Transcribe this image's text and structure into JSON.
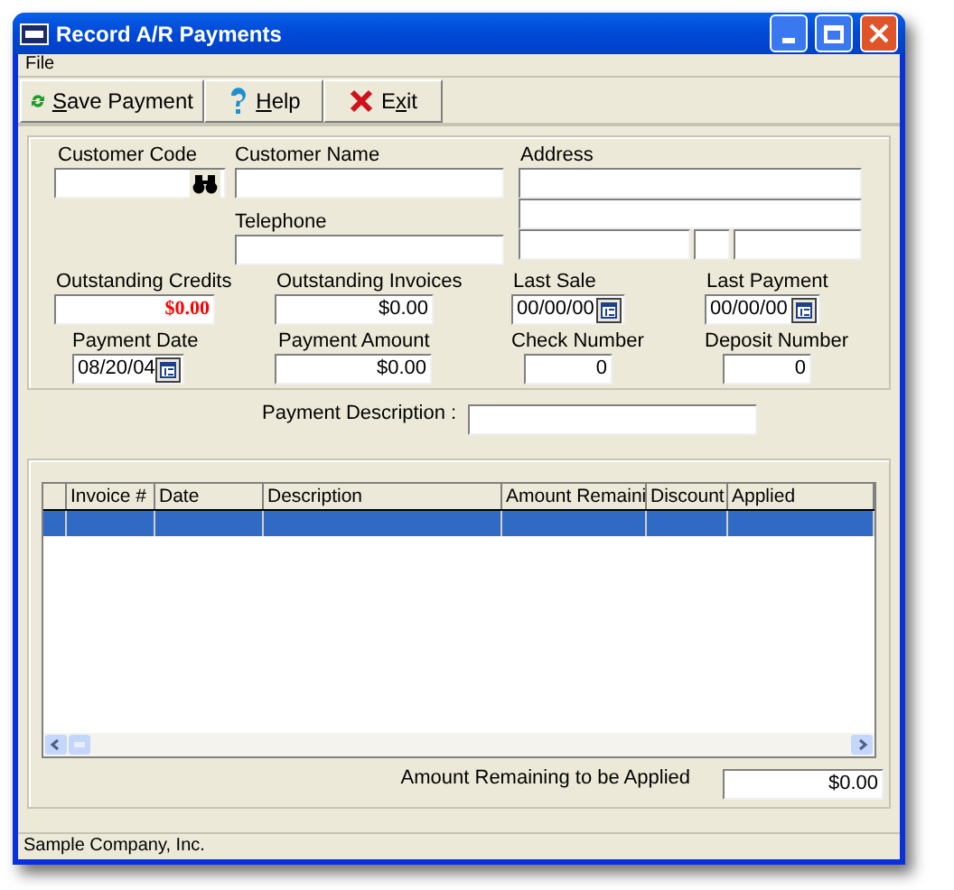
{
  "window": {
    "title": "Record A/R Payments"
  },
  "menu": [
    "File"
  ],
  "toolbar": [
    {
      "kind": "save",
      "accel": "S",
      "after": "ave Payment"
    },
    {
      "kind": "help",
      "accel": "H",
      "after": "elp"
    },
    {
      "kind": "exit",
      "before": "E",
      "accel": "x",
      "after": "it"
    }
  ],
  "customer": {
    "code_label": "Customer Code",
    "name_label": "Customer Name",
    "telephone_label": "Telephone",
    "address_label": "Address"
  },
  "summary": [
    {
      "label": "Outstanding Credits",
      "value": "$0.00",
      "kind": "money",
      "emphasis": true
    },
    {
      "label": "Outstanding Invoices",
      "value": "$0.00",
      "kind": "money",
      "emphasis": false
    },
    {
      "label": "Last Sale",
      "value": "00/00/00",
      "kind": "date",
      "emphasis": false
    },
    {
      "label": "Last Payment",
      "value": "00/00/00",
      "kind": "date",
      "emphasis": false
    }
  ],
  "payment": [
    {
      "label": "Payment Date",
      "value": "08/20/04",
      "kind": "date"
    },
    {
      "label": "Payment Amount",
      "value": "$0.00",
      "kind": "money"
    },
    {
      "label": "Check Number",
      "value": "0",
      "kind": "number"
    },
    {
      "label": "Deposit Number",
      "value": "0",
      "kind": "number"
    }
  ],
  "description": {
    "label": "Payment Description :"
  },
  "table": {
    "columns": [
      "Invoice #",
      "Date",
      "Description",
      "Amount Remaini",
      "Discount",
      "Applied"
    ],
    "rows": [
      {
        "selected": true
      }
    ]
  },
  "remaining": {
    "label": "Amount Remaining to be Applied",
    "value": "$0.00"
  },
  "status_bar": "Sample Company, Inc."
}
